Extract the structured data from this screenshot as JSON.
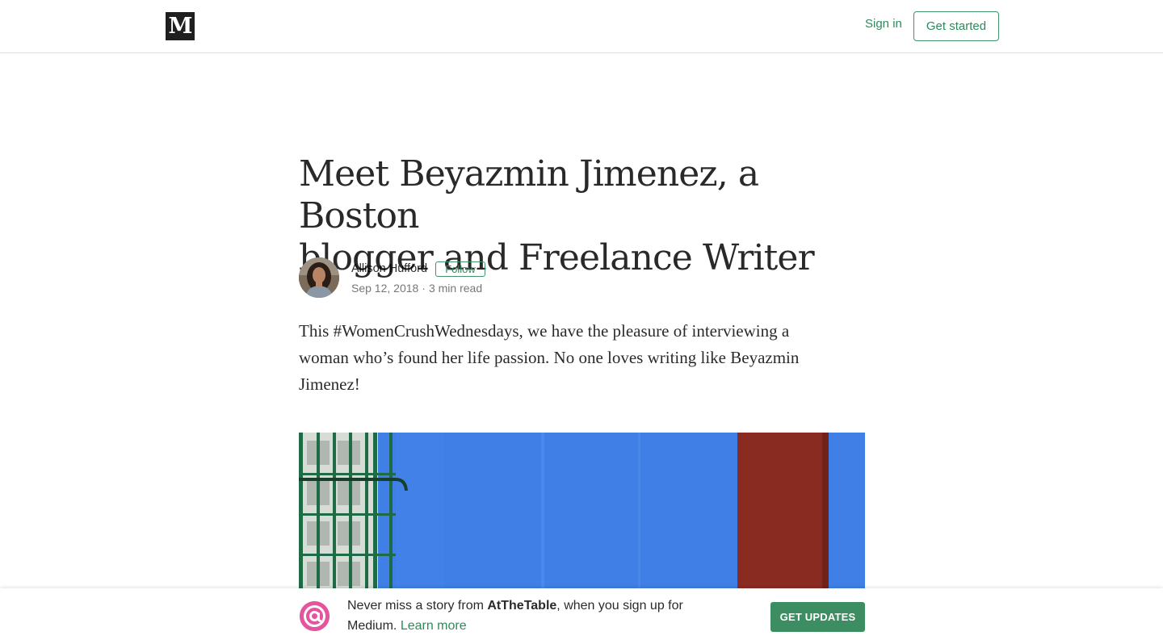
{
  "header": {
    "logo_text": "M",
    "sign_in_label": "Sign in",
    "get_started_label": "Get started"
  },
  "article": {
    "title_line1": "Meet Beyazmin Jimenez, a Boston",
    "title_line2": "blogger and Freelance Writer",
    "author": {
      "name": "Allison Hufford",
      "follow_label": "Follow",
      "date": "Sep 12, 2018",
      "separator": "·",
      "read_time": "3 min read"
    },
    "lead_line1": "This #WomenCrushWednesdays, we have the pleasure of interviewing a",
    "lead_line2": "woman who’s found her life passion. No one loves writing like Beyazmin",
    "lead_line3": "Jimenez!"
  },
  "banner": {
    "text_prefix": "Never miss a story from ",
    "publication": "AtTheTable",
    "text_suffix_line1": ", when you sign up for",
    "text_line2": "Medium.",
    "learn_more_label": "Learn more",
    "get_updates_label": "GET UPDATES",
    "pub_icon_glyph": "@"
  },
  "colors": {
    "accent_green": "#2f8a5b",
    "button_green": "#3d8d62",
    "pub_logo_pink": "#e4559d",
    "wall_blue": "#3f7fe6",
    "door_red": "#8a2b22"
  },
  "icons": {
    "brand": "medium-logo-icon",
    "publication": "at-sign-icon"
  }
}
